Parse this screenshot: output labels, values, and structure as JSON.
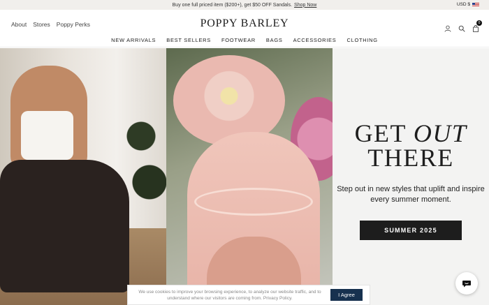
{
  "announcement": {
    "text": "Buy one full priced item ($200+), get $50 OFF Sandals.",
    "link": "Shop Now"
  },
  "currency": {
    "label": "USD $"
  },
  "header": {
    "util_links": [
      "About",
      "Stores",
      "Poppy Perks"
    ],
    "logo": "POPPY BARLEY",
    "cart_count": "0"
  },
  "nav": [
    "NEW ARRIVALS",
    "BEST SELLERS",
    "FOOTWEAR",
    "BAGS",
    "ACCESSORIES",
    "CLOTHING"
  ],
  "hero": {
    "headline_part1": "GET",
    "headline_italic": "OUT",
    "headline_part2": "THERE",
    "subtext": "Step out in new styles that uplift and inspire every summer moment.",
    "cta": "SUMMER 2025"
  },
  "cookie": {
    "message": "We use cookies to improve your browsing experience, to analyze our website traffic, and to understand where our visitors are coming from. Privacy Policy.",
    "button": "I Agree"
  },
  "colors": {
    "cta_bg": "#1d1d1d",
    "agree_bg": "#17314f",
    "promo_bg": "#f3f3f2"
  },
  "icons": [
    "account-icon",
    "search-icon",
    "cart-icon",
    "chat-icon",
    "us-flag-icon"
  ]
}
